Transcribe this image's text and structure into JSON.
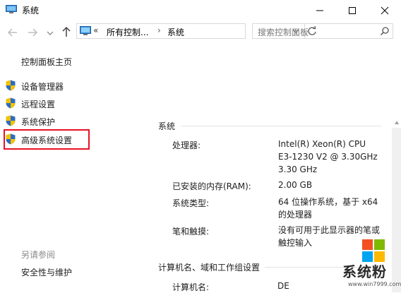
{
  "window": {
    "title": "系统"
  },
  "nav": {
    "breadcrumb_sep": "«",
    "breadcrumb": [
      "所有控制...",
      "系统"
    ],
    "crumb_arrow": "›",
    "search_placeholder": "搜索控制面板"
  },
  "left_pane": {
    "home": "控制面板主页",
    "items": [
      {
        "label": "设备管理器",
        "icon": "shield-icon"
      },
      {
        "label": "远程设置",
        "icon": "shield-icon"
      },
      {
        "label": "系统保护",
        "icon": "shield-icon"
      },
      {
        "label": "高级系统设置",
        "icon": "shield-icon",
        "highlighted": true
      }
    ],
    "see_also_title": "另请参阅",
    "see_also_link": "安全性与维护"
  },
  "system_section": {
    "title": "系统",
    "rows": [
      {
        "label": "处理器:",
        "lines": [
          "Intel(R) Xeon(R) CPU",
          "E3-1230 V2 @ 3.30GHz",
          "3.30 GHz"
        ]
      },
      {
        "label": "已安装的内存(RAM):",
        "lines": [
          "2.00 GB"
        ]
      },
      {
        "label": "系统类型:",
        "lines": [
          "64 位操作系统，基于 x64",
          "的处理器"
        ]
      },
      {
        "label": "笔和触摸:",
        "lines": [
          "没有可用于此显示器的笔或",
          "触控输入"
        ]
      }
    ]
  },
  "computer_section": {
    "title": "计算机名、域和工作组设置",
    "rows": [
      {
        "label": "计算机名:",
        "value": "DE"
      }
    ]
  },
  "watermark": {
    "text": "系统粉",
    "url": "www.win7999.com"
  },
  "colors": {
    "highlight_border": "#e81123",
    "shield_blue": "#2d6cc0",
    "shield_yellow": "#f2c200"
  }
}
